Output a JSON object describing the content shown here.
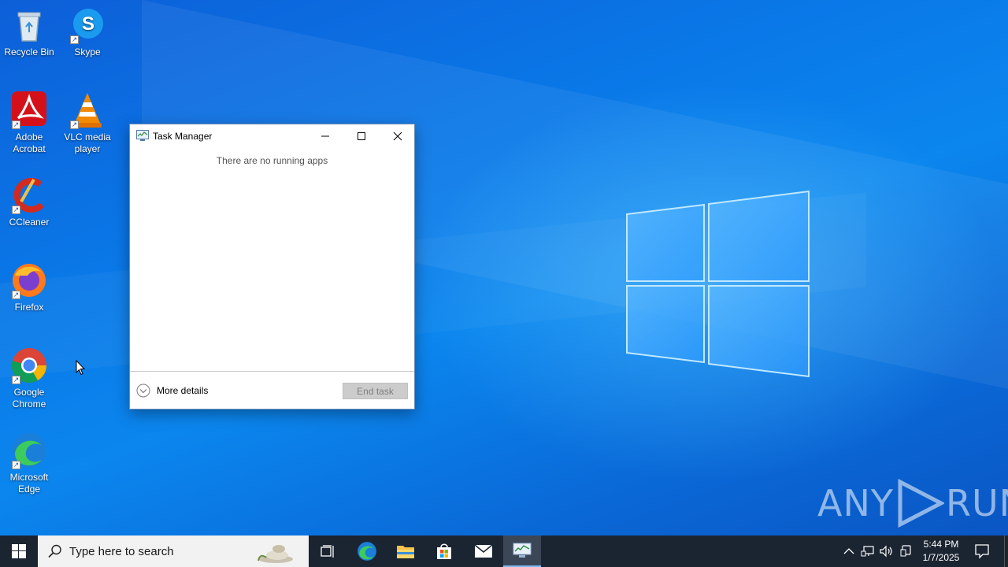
{
  "desktop": {
    "icons": [
      {
        "label": "Recycle Bin",
        "icon": "recycle-bin-icon"
      },
      {
        "label": "Skype",
        "icon": "skype-icon"
      },
      {
        "label": "Adobe Acrobat",
        "icon": "adobe-acrobat-icon"
      },
      {
        "label": "VLC media player",
        "icon": "vlc-icon"
      },
      {
        "label": "CCleaner",
        "icon": "ccleaner-icon"
      },
      {
        "label": "Firefox",
        "icon": "firefox-icon"
      },
      {
        "label": "Google Chrome",
        "icon": "chrome-icon"
      },
      {
        "label": "Microsoft Edge",
        "icon": "edge-icon"
      }
    ]
  },
  "task_manager": {
    "title": "Task Manager",
    "empty_message": "There are no running apps",
    "more_details_label": "More details",
    "end_task_label": "End task"
  },
  "taskbar": {
    "search_placeholder": "Type here to search",
    "apps": [
      "task-view-icon",
      "edge-icon",
      "file-explorer-icon",
      "store-icon",
      "mail-icon",
      "task-manager-icon"
    ],
    "clock": {
      "time": "5:44 PM",
      "date": "1/7/2025"
    }
  },
  "watermark": {
    "text_left": "ANY",
    "text_right": "RUN"
  },
  "colors": {
    "accent": "#0a63c9",
    "taskbar": "#1b2431",
    "end_task_disabled": "#cccccc"
  }
}
